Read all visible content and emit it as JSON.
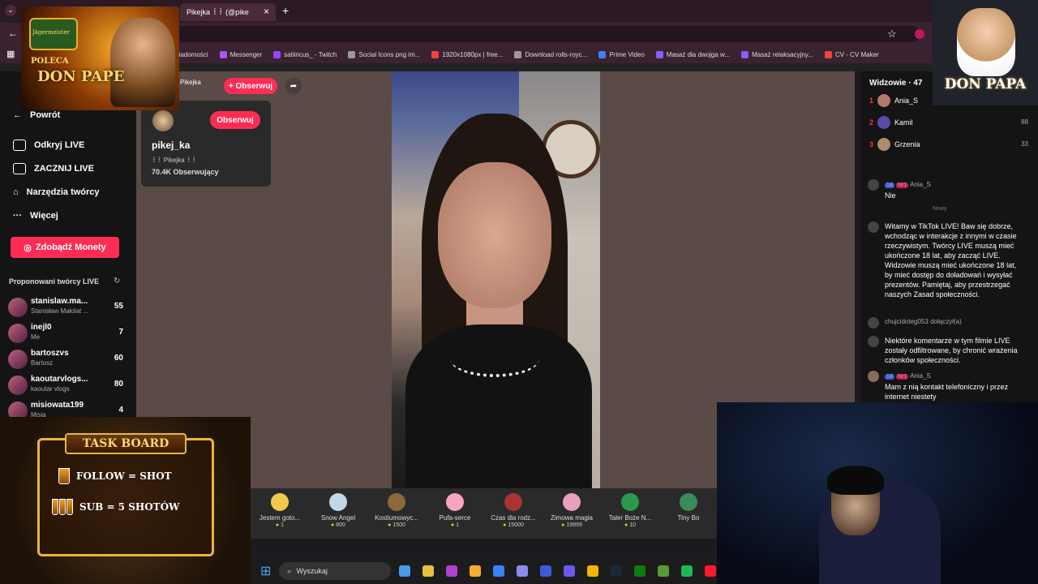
{
  "browser": {
    "tab_title": "Pikejka ꒰꒱ (@pike",
    "tab_close": "×",
    "new_tab": "+",
    "bookmarks": [
      {
        "label": "Wiadomości",
        "color": "#3b82f6"
      },
      {
        "label": "Messenger",
        "color": "#a855f7"
      },
      {
        "label": "satiiricus_ - Twitch",
        "color": "#9146ff"
      },
      {
        "label": "Social Icons png im...",
        "color": "#999999"
      },
      {
        "label": "1920x1080px | free...",
        "color": "#ef4444"
      },
      {
        "label": "Download rolls-royc...",
        "color": "#999999"
      },
      {
        "label": "Prime Video",
        "color": "#3b82f6"
      },
      {
        "label": "Masaż dla dwojga w...",
        "color": "#8b5cf6"
      },
      {
        "label": "Masaż relaksacyjny...",
        "color": "#8b5cf6"
      },
      {
        "label": "CV - CV Maker",
        "color": "#ef4444"
      }
    ]
  },
  "sidebar": {
    "nav": [
      {
        "label": "Powrót",
        "icon": "arrow-left-icon"
      },
      {
        "label": "Odkryj LIVE",
        "icon": "calendar-icon"
      },
      {
        "label": "ZACZNIJ LIVE",
        "icon": "video-camera-icon"
      },
      {
        "label": "Narzędzia twórcy",
        "icon": "home-icon"
      },
      {
        "label": "Więcej",
        "icon": "more-icon"
      }
    ],
    "coins_button": "Zdobądź Monety",
    "suggested_title": "Proponowani twórcy LIVE",
    "creators": [
      {
        "name": "stanislaw.ma...",
        "sub": "Stanisław Małolat ...",
        "count": "55"
      },
      {
        "name": "inejl0",
        "sub": "Me",
        "count": "7"
      },
      {
        "name": "bartoszvs",
        "sub": "Bartosz",
        "count": "60"
      },
      {
        "name": "kaoutarvlogs...",
        "sub": "kaoutar vlogs",
        "count": "80"
      },
      {
        "name": "misiowata199",
        "sub": "Misia",
        "count": "4"
      }
    ]
  },
  "stream": {
    "host_name": "Pikejka",
    "follow_label": "+ Obserwuj",
    "profile": {
      "username": "pikej_ka",
      "display": "꒰꒱ Pikejka ꒰꒱",
      "followers": "70.4K Obserwujący",
      "follow_button": "Obserwuj"
    }
  },
  "gifts": [
    {
      "name": "Jestem goto...",
      "price": "1",
      "color": "#f2c94c"
    },
    {
      "name": "Snow Angel",
      "price": "800",
      "color": "#c0d8e8"
    },
    {
      "name": "Kostiumowyc...",
      "price": "1500",
      "color": "#8a6a3a"
    },
    {
      "name": "Pufa-serce",
      "price": "1",
      "color": "#f6a5c0"
    },
    {
      "name": "Czas dla rodz...",
      "price": "15000",
      "color": "#a33"
    },
    {
      "name": "Zimowa magia",
      "price": "19999",
      "color": "#e8a0c0"
    },
    {
      "name": "Taler Boże N...",
      "price": "10",
      "color": "#2a9a4a"
    },
    {
      "name": "Tiny Bo",
      "price": "",
      "color": "#3a8a5a"
    }
  ],
  "taskbar": {
    "search_label": "Wyszukaj",
    "apps": [
      "#4a9ae8",
      "#e8c040",
      "#b040d0",
      "#f2b030",
      "#3b82f6",
      "#8a8af0",
      "#3b5bdb",
      "#6a5af0",
      "#f4b400",
      "#1b2838",
      "#107c10",
      "#5a9a3a",
      "#1db954",
      "#ff1b2d"
    ]
  },
  "chat": {
    "viewers_label": "Widzowie · 47",
    "ranking": [
      {
        "rank": "1",
        "user": "Ania_S",
        "count": "",
        "color": "#b07a6a"
      },
      {
        "rank": "2",
        "user": "Kamil",
        "count": "88",
        "color": "#5a4aa8"
      },
      {
        "rank": "3",
        "user": "Grzenia",
        "count": "33",
        "color": "#b08a6a"
      }
    ],
    "first_msg": {
      "user": "Ania_S",
      "level": "14",
      "rank": "Nr1",
      "text": "Nie"
    },
    "new_label": "Nowy",
    "welcome": "Witamy w TikTok LIVE! Baw się dobrze, wchodząc w interakcje z innymi w czasie rzeczywistym. Twórcy LIVE muszą mieć ukończone 18 lat, aby zacząć LIVE. Widzowie muszą mieć ukończone 18 lat, by mieć dostęp do doładowań i wysyłać prezentów. Pamiętaj, aby przestrzegać naszych Zasad społeczności.",
    "joined": {
      "user": "chujcidoteg053",
      "text": "dołączył(a)"
    },
    "filtered": "Niektóre komentarze w tym filmie LIVE zostały odfiltrowane, by chronić wrażenia członków społeczności.",
    "last_msg": {
      "user": "Ania_S",
      "level": "14",
      "rank": "Nr1",
      "text": "Mam z nią kontakt telefoniczny i przez internet niestety"
    }
  },
  "overlays": {
    "sponsor_brand": "Jägermeister",
    "sponsor_line1": "POLECA",
    "sponsor_line2": "DON PAPE",
    "donpapa": "DON PAPA",
    "taskboard_title": "TASK BOARD",
    "task1": "FOLLOW = SHOT",
    "task2": "SUB = 5 SHOTÓW"
  }
}
